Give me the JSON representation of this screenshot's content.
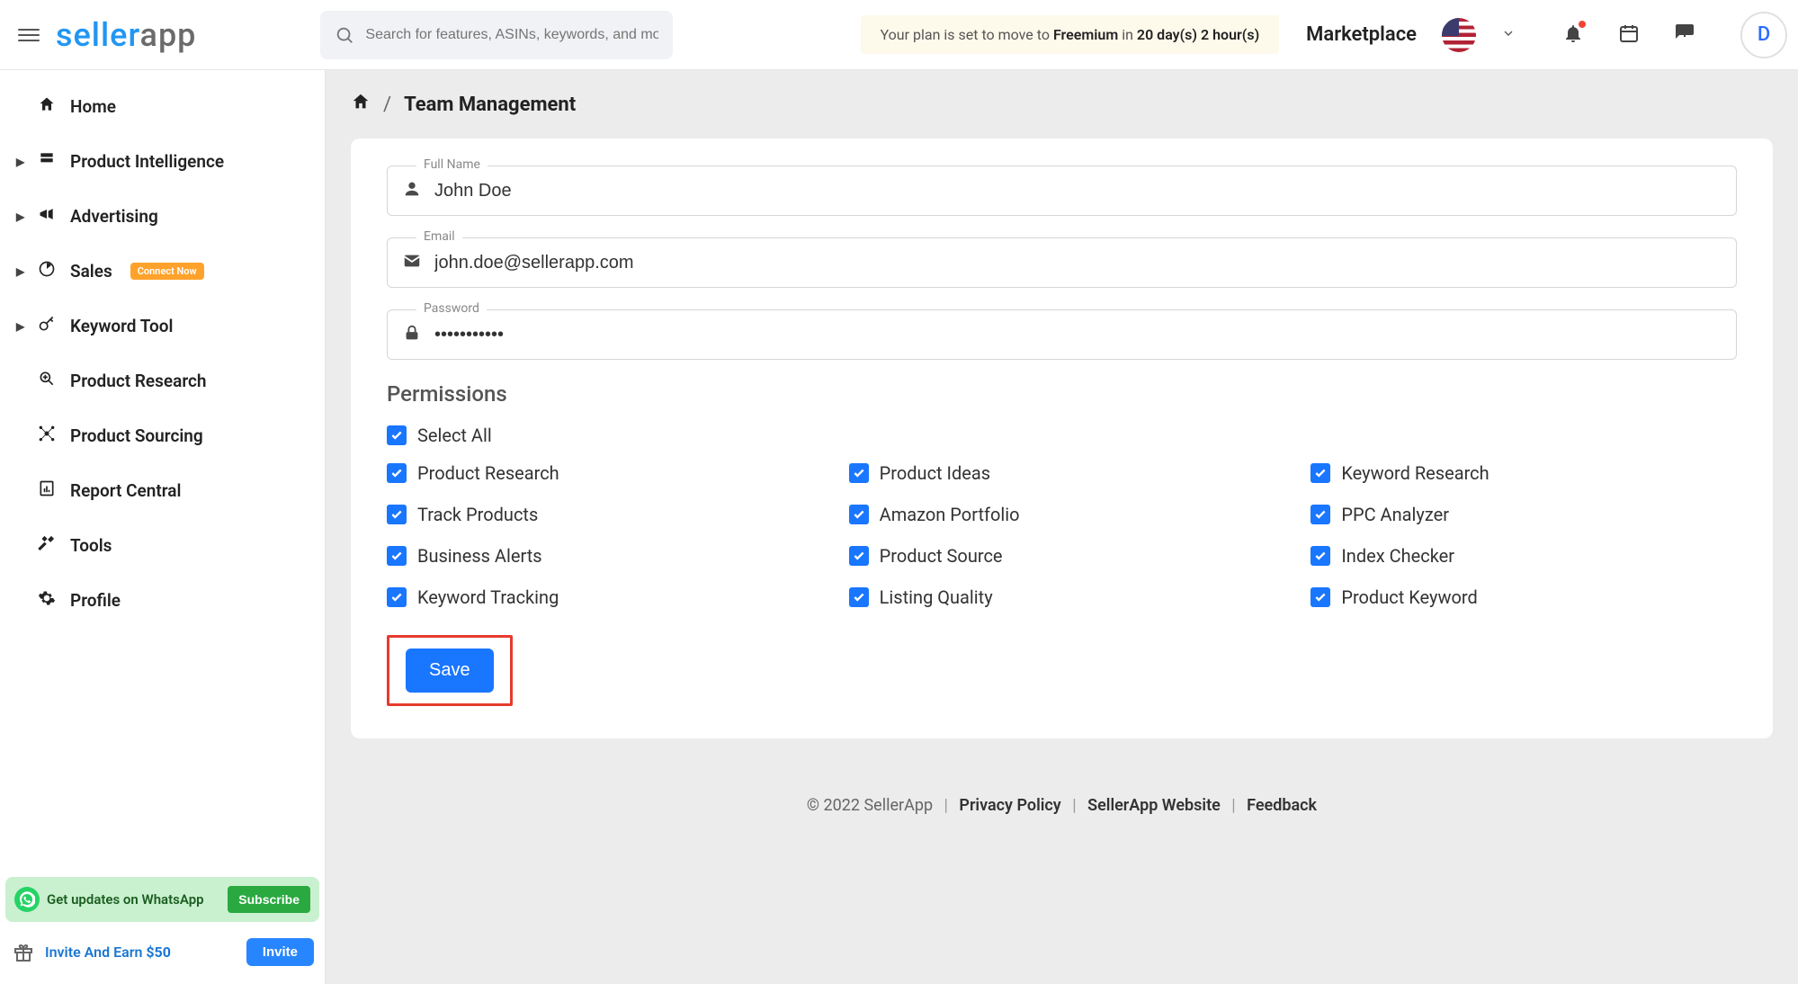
{
  "header": {
    "logo_part1": "seller",
    "logo_part2": "app",
    "search_placeholder": "Search for features, ASINs, keywords, and more",
    "plan_prefix": "Your plan is set to move to ",
    "plan_name": "Freemium",
    "plan_in": " in ",
    "plan_time": "20 day(s) 2 hour(s)",
    "marketplace_label": "Marketplace",
    "avatar_initial": "D"
  },
  "sidebar": {
    "items": [
      {
        "label": "Home",
        "has_caret": false,
        "icon": "home"
      },
      {
        "label": "Product Intelligence",
        "has_caret": true,
        "icon": "layers"
      },
      {
        "label": "Advertising",
        "has_caret": true,
        "icon": "megaphone"
      },
      {
        "label": "Sales",
        "has_caret": true,
        "icon": "analytics",
        "badge": "Connect Now"
      },
      {
        "label": "Keyword Tool",
        "has_caret": true,
        "icon": "key"
      },
      {
        "label": "Product Research",
        "has_caret": false,
        "icon": "zoom"
      },
      {
        "label": "Product Sourcing",
        "has_caret": false,
        "icon": "network"
      },
      {
        "label": "Report Central",
        "has_caret": false,
        "icon": "report"
      },
      {
        "label": "Tools",
        "has_caret": false,
        "icon": "tools"
      },
      {
        "label": "Profile",
        "has_caret": false,
        "icon": "gear"
      }
    ],
    "whatsapp_text": "Get updates on WhatsApp",
    "whatsapp_btn": "Subscribe",
    "invite_text": "Invite And Earn ",
    "invite_amount": "$50",
    "invite_btn": "Invite"
  },
  "breadcrumb": {
    "separator": "/",
    "current": "Team Management"
  },
  "form": {
    "full_name_label": "Full Name",
    "full_name_value": "John Doe",
    "email_label": "Email",
    "email_value": "john.doe@sellerapp.com",
    "password_label": "Password",
    "password_value": "•••••••••••",
    "permissions_title": "Permissions",
    "select_all_label": "Select All",
    "permissions_col1": [
      "Product Research",
      "Track Products",
      "Business Alerts",
      "Keyword Tracking"
    ],
    "permissions_col2": [
      "Product Ideas",
      "Amazon Portfolio",
      "Product Source",
      "Listing Quality"
    ],
    "permissions_col3": [
      "Keyword Research",
      "PPC Analyzer",
      "Index Checker",
      "Product Keyword"
    ],
    "save_label": "Save"
  },
  "footer": {
    "copyright": "© 2022 SellerApp",
    "links": [
      "Privacy Policy",
      "SellerApp Website",
      "Feedback"
    ]
  }
}
